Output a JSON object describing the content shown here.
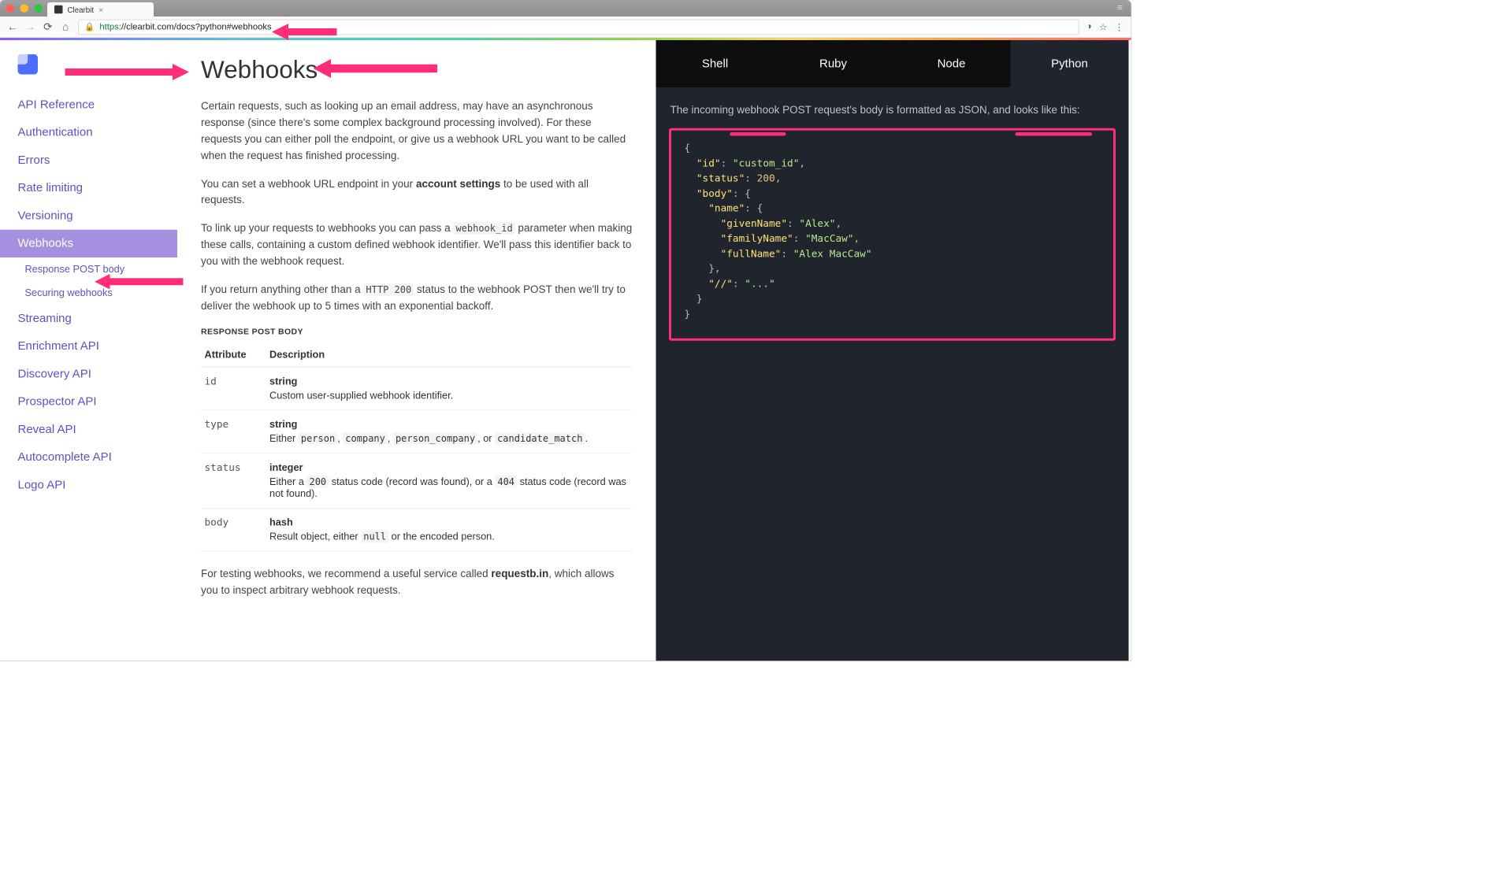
{
  "browser": {
    "tab_title": "Clearbit",
    "url_secure_part": "https",
    "url_host": "://clearbit.com",
    "url_path": "/docs?python#webhooks"
  },
  "sidebar": {
    "items": [
      "API Reference",
      "Authentication",
      "Errors",
      "Rate limiting",
      "Versioning",
      "Webhooks"
    ],
    "active_index": 5,
    "sub_items": [
      "Response POST body",
      "Securing webhooks"
    ],
    "items_after": [
      "Streaming",
      "Enrichment API",
      "Discovery API",
      "Prospector API",
      "Reveal API",
      "Autocomplete API",
      "Logo API"
    ]
  },
  "main": {
    "title": "Webhooks",
    "p1": "Certain requests, such as looking up an email address, may have an asynchronous response (since there's some complex background processing involved). For these requests you can either poll the endpoint, or give us a webhook URL you want to be called when the request has finished processing.",
    "p2_a": "You can set a webhook URL endpoint in your ",
    "p2_link": "account settings",
    "p2_b": " to be used with all requests.",
    "p3_a": "To link up your requests to webhooks you can pass a ",
    "p3_code": "webhook_id",
    "p3_b": " parameter when making these calls, containing a custom defined webhook identifier. We'll pass this identifier back to you with the webhook request.",
    "p4_a": "If you return anything other than a ",
    "p4_code": "HTTP 200",
    "p4_b": " status to the webhook POST then we'll try to deliver the webhook up to 5 times with an exponential backoff.",
    "section_title": "RESPONSE POST BODY",
    "th1": "Attribute",
    "th2": "Description",
    "rows": [
      {
        "attr": "id",
        "type": "string",
        "desc": "Custom user-supplied webhook identifier."
      },
      {
        "attr": "type",
        "type": "string",
        "desc": "Either ",
        "codes": [
          "person",
          "company",
          "person_company",
          "candidate_match"
        ],
        "desc_suffix": "."
      },
      {
        "attr": "status",
        "type": "integer",
        "desc": "Either a ",
        "code1": "200",
        "desc_mid": " status code (record was found), or a ",
        "code2": "404",
        "desc_suffix": " status code (record was not found)."
      },
      {
        "attr": "body",
        "type": "hash",
        "desc": "Result object, either ",
        "code1": "null",
        "desc_suffix": " or the encoded person."
      }
    ],
    "p5_a": "For testing webhooks, we recommend a useful service called ",
    "p5_link": "requestb.in",
    "p5_b": ", which allows you to inspect arbitrary webhook requests."
  },
  "codepane": {
    "tabs": [
      "Shell",
      "Ruby",
      "Node",
      "Python"
    ],
    "active_index": 3,
    "desc": "The incoming webhook POST request's body is formatted as JSON, and looks like this:",
    "json": {
      "id": "custom_id",
      "status": 200,
      "body": {
        "name": {
          "givenName": "Alex",
          "familyName": "MacCaw",
          "fullName": "Alex MacCaw"
        },
        "//": "..."
      }
    }
  }
}
